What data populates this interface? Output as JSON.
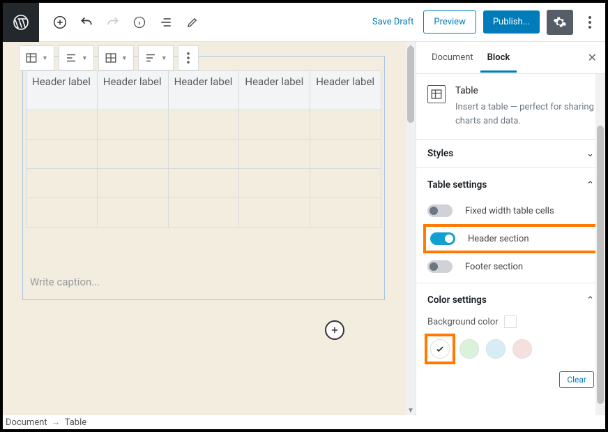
{
  "topbar": {
    "save_draft": "Save Draft",
    "preview": "Preview",
    "publish": "Publish..."
  },
  "block_toolbar": {
    "items": [
      "table-icon",
      "align-icon",
      "table-edit-icon",
      "text-align-icon",
      "more-icon"
    ]
  },
  "table": {
    "headers": [
      "Header label",
      "Header label",
      "Header label",
      "Header label",
      "Header label"
    ],
    "rows": 4,
    "cols": 5,
    "caption_placeholder": "Write caption..."
  },
  "sidebar": {
    "tabs": {
      "document": "Document",
      "block": "Block"
    },
    "block_info": {
      "title": "Table",
      "description": "Insert a table — perfect for sharing charts and data."
    },
    "panels": {
      "styles": {
        "title": "Styles",
        "expanded": false
      },
      "table_settings": {
        "title": "Table settings",
        "expanded": true,
        "toggles": {
          "fixed_width": {
            "label": "Fixed width table cells",
            "on": false
          },
          "header_section": {
            "label": "Header section",
            "on": true
          },
          "footer_section": {
            "label": "Footer section",
            "on": false
          }
        }
      },
      "color_settings": {
        "title": "Color settings",
        "expanded": true,
        "background_label": "Background color",
        "colors": [
          "#ffffff",
          "#d4f0d4",
          "#d4e8f7",
          "#f5dedc"
        ],
        "selected_index": 0,
        "clear": "Clear"
      }
    }
  },
  "breadcrumb": {
    "root": "Document",
    "current": "Table"
  }
}
